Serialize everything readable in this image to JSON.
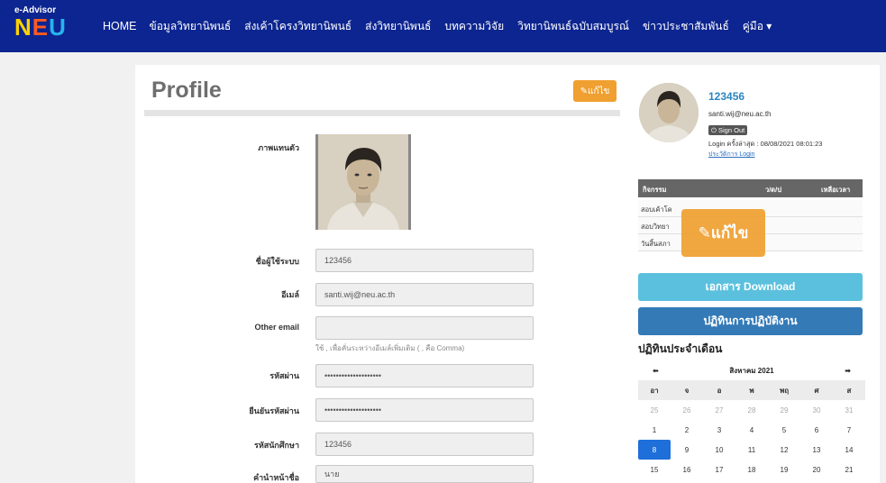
{
  "brand": {
    "small": "e-Advisor",
    "big_n": "N",
    "big_e": "E",
    "big_u": "U"
  },
  "nav": [
    "HOME",
    "ข้อมูลวิทยานิพนธ์",
    "ส่งเค้าโครงวิทยานิพนธ์",
    "ส่งวิทยานิพนธ์",
    "บทความวิจัย",
    "วิทยานิพนธ์ฉบับสมบูรณ์",
    "ข่าวประชาสัมพันธ์",
    "คู่มือ ▾"
  ],
  "profile": {
    "title": "Profile",
    "edit_label": "✎แก้ไข",
    "fields": {
      "photo_label": "ภาพแทนตัว",
      "username_label": "ชื่อผู้ใช้ระบบ",
      "username_value": "123456",
      "email_label": "อีเมล์",
      "email_value": "santi.wij@neu.ac.th",
      "other_email_label": "Other email",
      "other_email_value": "",
      "other_email_hint": "ใช้ , เพื่อคั่นระหว่างอีเมล์เพิ่มเติม ( , คือ Comma)",
      "password_label": "รหัสผ่าน",
      "password_value": "••••••••••••••••••••",
      "confirm_label": "ยืนยันรหัสผ่าน",
      "confirm_value": "••••••••••••••••••••",
      "student_id_label": "รหัสนักศึกษา",
      "student_id_value": "123456",
      "prefix_label": "คำนำหน้าชื่อ",
      "prefix_value": "นาย"
    }
  },
  "user": {
    "name": "123456",
    "email": "santi.wij@neu.ac.th",
    "signout": "⏻ Sign Out",
    "last_login": "Login ครั้งล่าสุด : 08/08/2021 08:01:23",
    "login_history": "ประวัติการ Login"
  },
  "activities": {
    "headers": [
      "กิจกรรม",
      "ว/ด/ป",
      "เหลือเวลา"
    ],
    "rows": [
      "สอบเค้าโค",
      "สอบวิทยา",
      "วันสิ้นสภา"
    ]
  },
  "overlay_edit": "✎แก้ไข",
  "buttons": {
    "download": "เอกสาร Download",
    "calendar": "ปฏิทินการปฏิบัติงาน"
  },
  "calendar": {
    "title": "ปฏิทินประจำเดือน",
    "month": "สิงหาคม 2021",
    "prev": "⬅",
    "next": "➡",
    "dow": [
      "อา",
      "จ",
      "อ",
      "พ",
      "พฤ",
      "ศ",
      "ส"
    ],
    "weeks": [
      [
        "25",
        "26",
        "27",
        "28",
        "29",
        "30",
        "31"
      ],
      [
        "1",
        "2",
        "3",
        "4",
        "5",
        "6",
        "7"
      ],
      [
        "8",
        "9",
        "10",
        "11",
        "12",
        "13",
        "14"
      ],
      [
        "15",
        "16",
        "17",
        "18",
        "19",
        "20",
        "21"
      ]
    ],
    "today": "8"
  },
  "colors": {
    "navbar": "#0d2590",
    "accent_orange": "#f0a030",
    "info": "#5bc0de",
    "primary": "#337ab7"
  }
}
